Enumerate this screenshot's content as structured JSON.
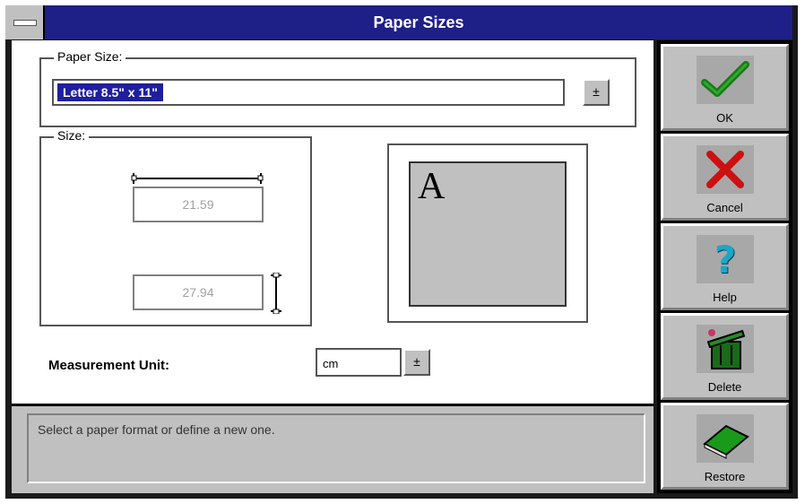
{
  "window": {
    "title": "Paper Sizes"
  },
  "paper_size": {
    "legend": "Paper Size:",
    "selected": "Letter 8.5\" x 11\"",
    "dropdown_glyph": "±"
  },
  "size": {
    "legend": "Size:",
    "width": "21.59",
    "height": "27.94"
  },
  "preview": {
    "letter": "A"
  },
  "measurement": {
    "label": "Measurement Unit:",
    "value": "cm",
    "dropdown_glyph": "±"
  },
  "status": {
    "text": "Select a paper format or define a new one."
  },
  "toolbar": {
    "ok_label": "OK",
    "cancel_label": "Cancel",
    "help_label": "Help",
    "delete_label": "Delete",
    "restore_label": "Restore"
  },
  "colors": {
    "title_bar": "#1f1f88",
    "face": "#c0c0c0",
    "ok_icon": "#1a7a1a",
    "cancel_icon": "#cc1111",
    "help_icon": "#1aa8c8",
    "delete_icon": "#1a6a1a",
    "restore_icon": "#1a9a1a"
  },
  "icons": [
    "checkmark-icon",
    "x-icon",
    "question-icon",
    "trash-can-icon",
    "book-icon"
  ]
}
